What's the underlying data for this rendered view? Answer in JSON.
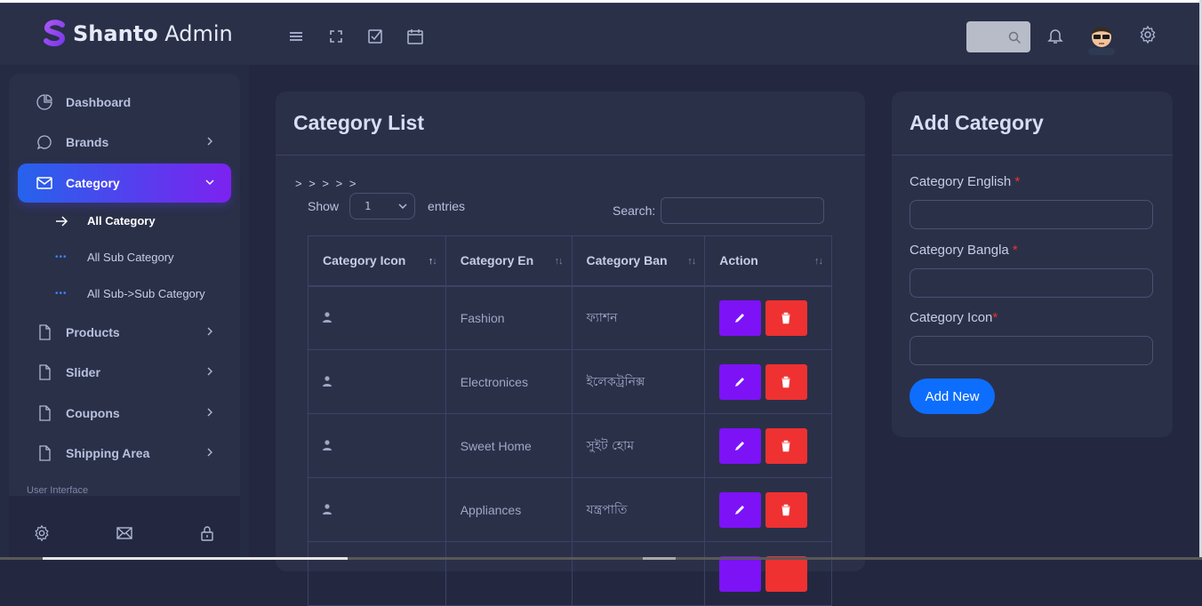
{
  "brand": {
    "name_bold": "Shanto",
    "name_rest": " Admin"
  },
  "topbar": {
    "icons": [
      "menu-icon",
      "fullscreen-icon",
      "checkbox-icon",
      "calendar-icon",
      "search-icon",
      "bell-icon",
      "gear-icon"
    ]
  },
  "sidebar": {
    "items": [
      {
        "label": "Dashboard",
        "icon": "pie-chart-icon"
      },
      {
        "label": "Brands",
        "icon": "chat-icon"
      },
      {
        "label": "Category",
        "icon": "mail-icon"
      },
      {
        "label": "Products",
        "icon": "file-icon"
      },
      {
        "label": "Slider",
        "icon": "file-icon"
      },
      {
        "label": "Coupons",
        "icon": "file-icon"
      },
      {
        "label": "Shipping Area",
        "icon": "file-icon"
      }
    ],
    "sub_items": [
      {
        "label": "All Category"
      },
      {
        "label": "All Sub Category"
      },
      {
        "label": "All Sub->Sub Category"
      }
    ],
    "section_label": "User Interface"
  },
  "category_list": {
    "title": "Category List",
    "breadcrumb": "> > > > >",
    "show_label": "Show",
    "entries_value": "1",
    "entries_label": "entries",
    "search_label": "Search:",
    "columns": [
      "Category Icon",
      "Category En",
      "Category Ban",
      "Action"
    ],
    "rows": [
      {
        "en": "Fashion",
        "ban": "ফ্যাশন"
      },
      {
        "en": "Electronices",
        "ban": "ইলেকট্রনিক্স"
      },
      {
        "en": "Sweet Home",
        "ban": "সুইট হোম"
      },
      {
        "en": "Appliances",
        "ban": "যন্ত্রপাতি"
      }
    ]
  },
  "add_category": {
    "title": "Add Category",
    "label_en": "Category English",
    "label_ban": "Category Bangla",
    "label_icon": "Category Icon",
    "required_mark": "*",
    "submit_label": "Add New"
  },
  "colors": {
    "accent_blue": "#0d6efd",
    "edit_purple": "#7d12f7",
    "delete_red": "#ef3131",
    "active_gradient_start": "#2563eb",
    "active_gradient_end": "#7c22f0"
  }
}
